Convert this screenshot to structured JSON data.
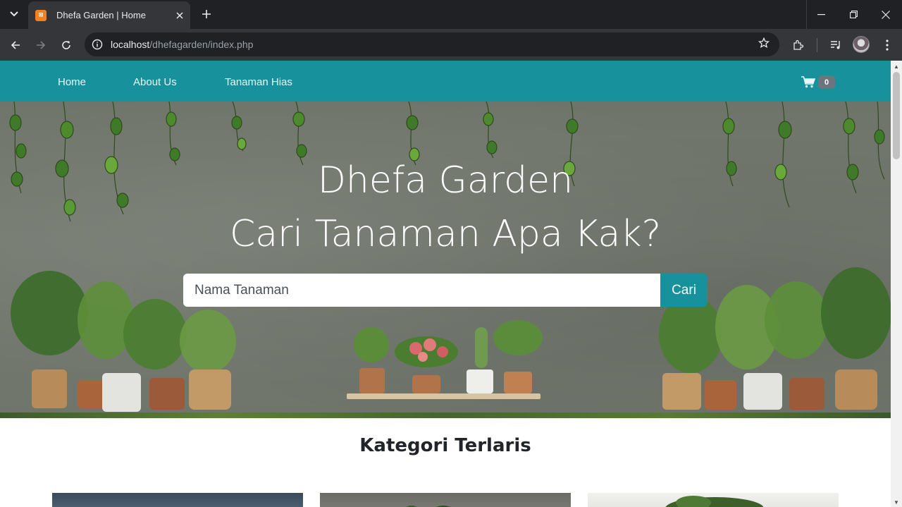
{
  "browser": {
    "tab_title": "Dhefa Garden | Home",
    "favicon_label": "⊠",
    "url_host": "localhost",
    "url_path": "/dhefagarden/index.php"
  },
  "navbar": {
    "links": [
      "Home",
      "About Us",
      "Tanaman Hias"
    ],
    "cart_count": "0"
  },
  "hero": {
    "title_line1": "Dhefa Garden",
    "title_line2": "Cari Tanaman Apa Kak?",
    "search_placeholder": "Nama Tanaman",
    "search_button": "Cari"
  },
  "section": {
    "title": "Kategori Terlaris"
  },
  "colors": {
    "brand": "#17929c",
    "badge": "#6c757d"
  }
}
